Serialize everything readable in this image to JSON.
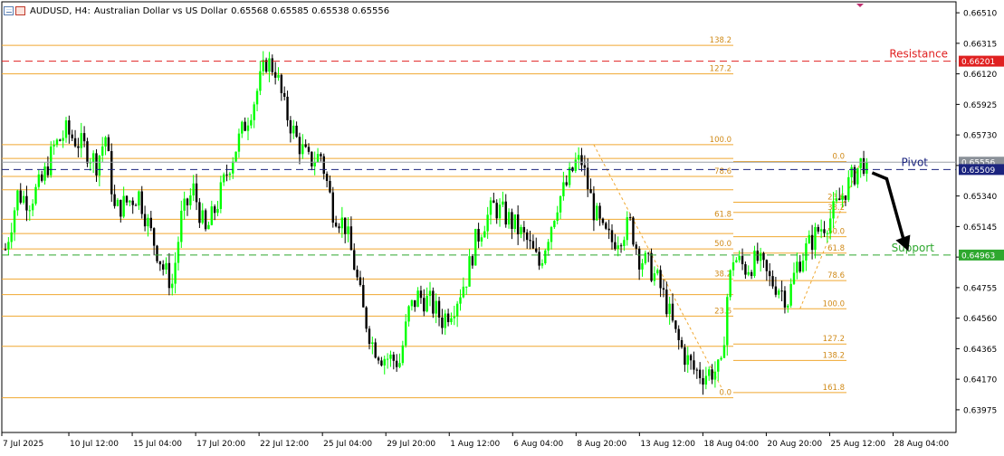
{
  "header": {
    "symbol": "AUDUSD, H4:",
    "description": "Australian Dollar vs US Dollar",
    "ohlc": "0.65568 0.65585 0.65538 0.65556"
  },
  "colors": {
    "bull": "#00ff00",
    "bear": "#000000",
    "fib": "#f0a830",
    "fib_label": "#d08a18",
    "resistance": "#e02020",
    "pivot": "#1a237e",
    "support": "#2ea82e",
    "price_line": "#9aa0a6",
    "axis": "#000000"
  },
  "chart_data": {
    "type": "candlestick",
    "symbol": "AUDUSD",
    "timeframe": "H4",
    "ylim": [
      0.6383,
      0.6658
    ],
    "y_ticks": [
      "0.66510",
      "0.66315",
      "0.66120",
      "0.65925",
      "0.65730",
      "0.65535",
      "0.65340",
      "0.65145",
      "0.64950",
      "0.64755",
      "0.64560",
      "0.64365",
      "0.64170",
      "0.63975"
    ],
    "x_ticks": [
      "7 Jul 2025",
      "10 Jul 12:00",
      "15 Jul 04:00",
      "17 Jul 20:00",
      "22 Jul 12:00",
      "25 Jul 04:00",
      "29 Jul 20:00",
      "1 Aug 12:00",
      "6 Aug 04:00",
      "8 Aug 20:00",
      "13 Aug 12:00",
      "18 Aug 04:00",
      "20 Aug 20:00",
      "25 Aug 12:00",
      "28 Aug 04:00"
    ],
    "price_path": [
      [
        0,
        0.65
      ],
      [
        4,
        0.6535
      ],
      [
        8,
        0.6531
      ],
      [
        12,
        0.6543
      ],
      [
        16,
        0.6565
      ],
      [
        20,
        0.6575
      ],
      [
        26,
        0.6565
      ],
      [
        30,
        0.6555
      ],
      [
        33,
        0.6572
      ],
      [
        36,
        0.6525
      ],
      [
        40,
        0.653
      ],
      [
        44,
        0.6535
      ],
      [
        48,
        0.651
      ],
      [
        52,
        0.6488
      ],
      [
        55,
        0.6478
      ],
      [
        58,
        0.652
      ],
      [
        62,
        0.6538
      ],
      [
        66,
        0.651
      ],
      [
        70,
        0.653
      ],
      [
        74,
        0.6555
      ],
      [
        78,
        0.6575
      ],
      [
        82,
        0.6595
      ],
      [
        86,
        0.662
      ],
      [
        89,
        0.6615
      ],
      [
        92,
        0.659
      ],
      [
        96,
        0.657
      ],
      [
        100,
        0.6556
      ],
      [
        104,
        0.656
      ],
      [
        108,
        0.6525
      ],
      [
        112,
        0.6515
      ],
      [
        115,
        0.649
      ],
      [
        118,
        0.646
      ],
      [
        121,
        0.644
      ],
      [
        124,
        0.6432
      ],
      [
        127,
        0.643
      ],
      [
        130,
        0.6428
      ],
      [
        133,
        0.646
      ],
      [
        136,
        0.647
      ],
      [
        140,
        0.6466
      ],
      [
        144,
        0.6455
      ],
      [
        148,
        0.6465
      ],
      [
        152,
        0.6482
      ],
      [
        155,
        0.6505
      ],
      [
        158,
        0.6518
      ],
      [
        161,
        0.6527
      ],
      [
        164,
        0.6523
      ],
      [
        168,
        0.6515
      ],
      [
        172,
        0.6505
      ],
      [
        176,
        0.649
      ],
      [
        179,
        0.651
      ],
      [
        182,
        0.653
      ],
      [
        185,
        0.6541
      ],
      [
        188,
        0.6555
      ],
      [
        190,
        0.6556
      ],
      [
        192,
        0.654
      ],
      [
        194,
        0.6525
      ],
      [
        197,
        0.651
      ],
      [
        200,
        0.6505
      ],
      [
        203,
        0.651
      ],
      [
        206,
        0.6516
      ],
      [
        209,
        0.6495
      ],
      [
        212,
        0.649
      ],
      [
        215,
        0.648
      ],
      [
        218,
        0.6465
      ],
      [
        221,
        0.6445
      ],
      [
        224,
        0.6432
      ],
      [
        227,
        0.6423
      ],
      [
        230,
        0.642
      ],
      [
        233,
        0.6422
      ],
      [
        236,
        0.6423
      ],
      [
        238,
        0.647
      ],
      [
        240,
        0.6495
      ],
      [
        244,
        0.6488
      ],
      [
        248,
        0.6493
      ],
      [
        252,
        0.648
      ],
      [
        255,
        0.6476
      ],
      [
        258,
        0.6468
      ],
      [
        261,
        0.649
      ],
      [
        264,
        0.65
      ],
      [
        268,
        0.6512
      ],
      [
        272,
        0.652
      ],
      [
        276,
        0.6535
      ],
      [
        279,
        0.6545
      ],
      [
        282,
        0.6555
      ],
      [
        284,
        0.6556
      ]
    ],
    "last_price": 0.65556,
    "levels": [
      {
        "name": "Resistance",
        "value": 0.66201,
        "label": "0.66201"
      },
      {
        "name": "Pivot",
        "value": 0.65509,
        "label": "0.65509"
      },
      {
        "name": "Support",
        "value": 0.64963,
        "label": "0.64963"
      }
    ],
    "last_price_label": "0.65556",
    "fib_left": {
      "levels": [
        {
          "label": "138.2",
          "price": 0.66302
        },
        {
          "label": "127.2",
          "price": 0.6612
        },
        {
          "label": "100.0",
          "price": 0.65668
        },
        {
          "label": "0.0",
          "price": 0.64052
        },
        {
          "label": "23.6",
          "price": 0.64573
        },
        {
          "label": "38.2",
          "price": 0.6481
        },
        {
          "label": "50.0",
          "price": 0.65002
        },
        {
          "label": "61.8",
          "price": 0.65191
        },
        {
          "label": "78.6",
          "price": 0.65465
        }
      ],
      "extra_lines": [
        0.6558,
        0.6538,
        0.651,
        0.6471,
        0.6438
      ]
    },
    "fib_right": {
      "levels": [
        {
          "label": "0.0",
          "price": 0.6556
        },
        {
          "label": "23.6",
          "price": 0.653
        },
        {
          "label": "38.2",
          "price": 0.65235
        },
        {
          "label": "50.0",
          "price": 0.6508
        },
        {
          "label": "61.8",
          "price": 0.64975
        },
        {
          "label": "78.6",
          "price": 0.648
        },
        {
          "label": "100.0",
          "price": 0.6462
        },
        {
          "label": "127.2",
          "price": 0.64395
        },
        {
          "label": "138.2",
          "price": 0.6429
        },
        {
          "label": "161.8",
          "price": 0.64085
        }
      ]
    },
    "annotations": [
      {
        "text": "Resistance"
      },
      {
        "text": "Pivot"
      },
      {
        "text": "Support"
      }
    ]
  }
}
